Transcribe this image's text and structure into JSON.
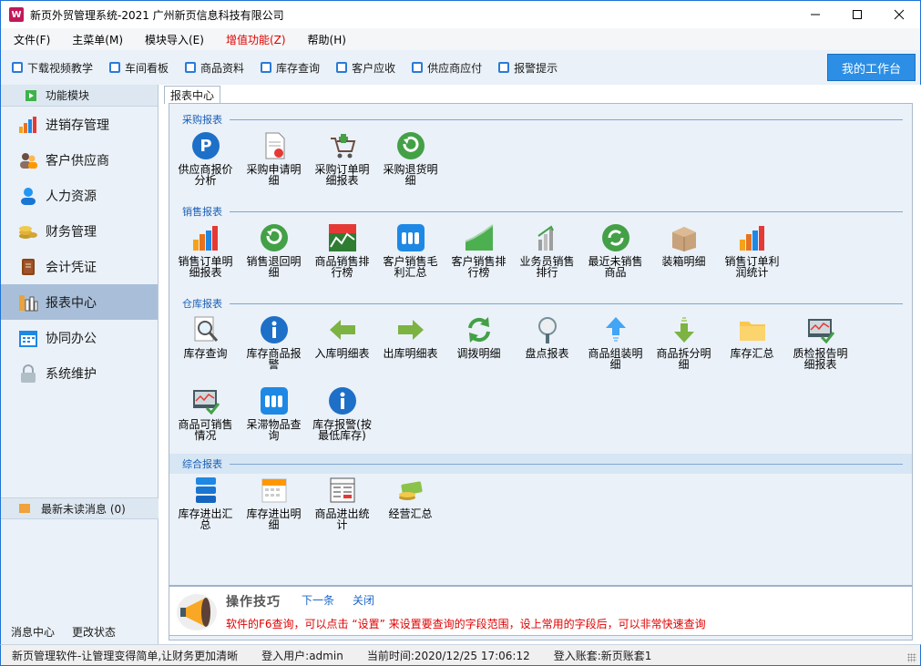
{
  "window": {
    "title": "新页外贸管理系统-2021 广州新页信息科技有限公司"
  },
  "menu": [
    "文件(F)",
    "主菜单(M)",
    "模块导入(E)",
    "增值功能(Z)",
    "帮助(H)"
  ],
  "toolbar": {
    "items": [
      "下载视频教学",
      "车间看板",
      "商品资料",
      "库存查询",
      "客户应收",
      "供应商应付",
      "报警提示"
    ],
    "workbench_label": "我的工作台"
  },
  "sidebar": {
    "header": "功能模块",
    "items": [
      "进销存管理",
      "客户供应商",
      "人力资源",
      "财务管理",
      "会计凭证",
      "报表中心",
      "协同办公",
      "系统维护"
    ],
    "message": "最新未读消息 (0)",
    "bottom": [
      "消息中心",
      "更改状态"
    ]
  },
  "main": {
    "tab": "报表中心",
    "sections": [
      {
        "title": "采购报表",
        "items": [
          "供应商报价分析",
          "采购申请明细",
          "采购订单明细报表",
          "采购退货明细"
        ]
      },
      {
        "title": "销售报表",
        "items": [
          "销售订单明细报表",
          "销售退回明细",
          "商品销售排行榜",
          "客户销售毛利汇总",
          "客户销售排行榜",
          "业务员销售排行",
          "最近未销售商品",
          "装箱明细",
          "销售订单利润统计"
        ]
      },
      {
        "title": "仓库报表",
        "items": [
          "库存查询",
          "库存商品报警",
          "入库明细表",
          "出库明细表",
          "调拨明细",
          "盘点报表",
          "商品组装明细",
          "商品拆分明细",
          "库存汇总",
          "质检报告明细报表",
          "商品可销售情况",
          "呆滞物品查询",
          "库存报警(按最低库存)"
        ]
      },
      {
        "title": "综合报表",
        "items": [
          "库存进出汇总",
          "库存进出明细",
          "商品进出统计",
          "经营汇总"
        ]
      }
    ]
  },
  "tips": {
    "title": "操作技巧",
    "next": "下一条",
    "close": "关闭",
    "text": "软件的F6查询，可以点击 “设置” 来设置要查询的字段范围，设上常用的字段后，可以非常快速查询"
  },
  "statusbar": {
    "slogan": "新页管理软件-让管理变得简单,让财务更加清晰",
    "user": "登入用户:admin",
    "time": "当前时间:2020/12/25 17:06:12",
    "account": "登入账套:新页账套1"
  }
}
